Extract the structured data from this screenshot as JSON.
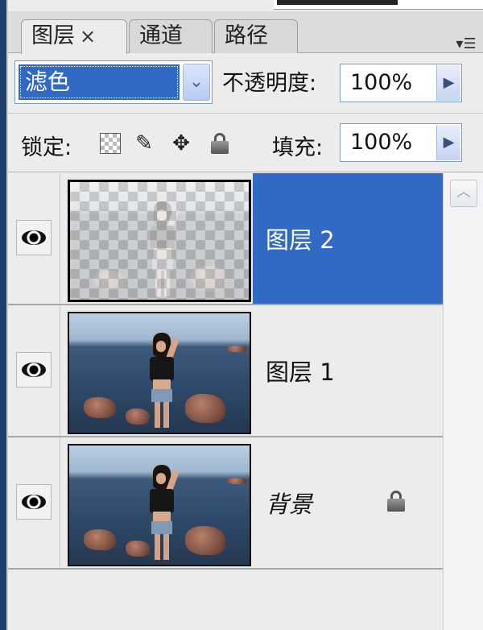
{
  "tabs": [
    {
      "label": "图层",
      "close": "×",
      "active": true
    },
    {
      "label": "通道",
      "active": false
    },
    {
      "label": "路径",
      "active": false
    }
  ],
  "panel_menu_icon": "panel-menu-icon",
  "blend_mode": {
    "value": "滤色"
  },
  "opacity": {
    "label": "不透明度:",
    "value": "100%"
  },
  "lock": {
    "label": "锁定:",
    "icons": [
      "lock-transparent-pixels-icon",
      "lock-image-pixels-brush-icon",
      "lock-position-move-icon",
      "lock-all-icon"
    ]
  },
  "fill": {
    "label": "填充:",
    "value": "100%"
  },
  "layers": [
    {
      "name": "图层 2",
      "selected": true,
      "visible": true,
      "locked": false
    },
    {
      "name": "图层 1",
      "selected": false,
      "visible": true,
      "locked": false
    },
    {
      "name": "背景",
      "selected": false,
      "visible": true,
      "locked": true
    }
  ],
  "colors": {
    "selection": "#316ac5",
    "panel": "#ececec"
  }
}
